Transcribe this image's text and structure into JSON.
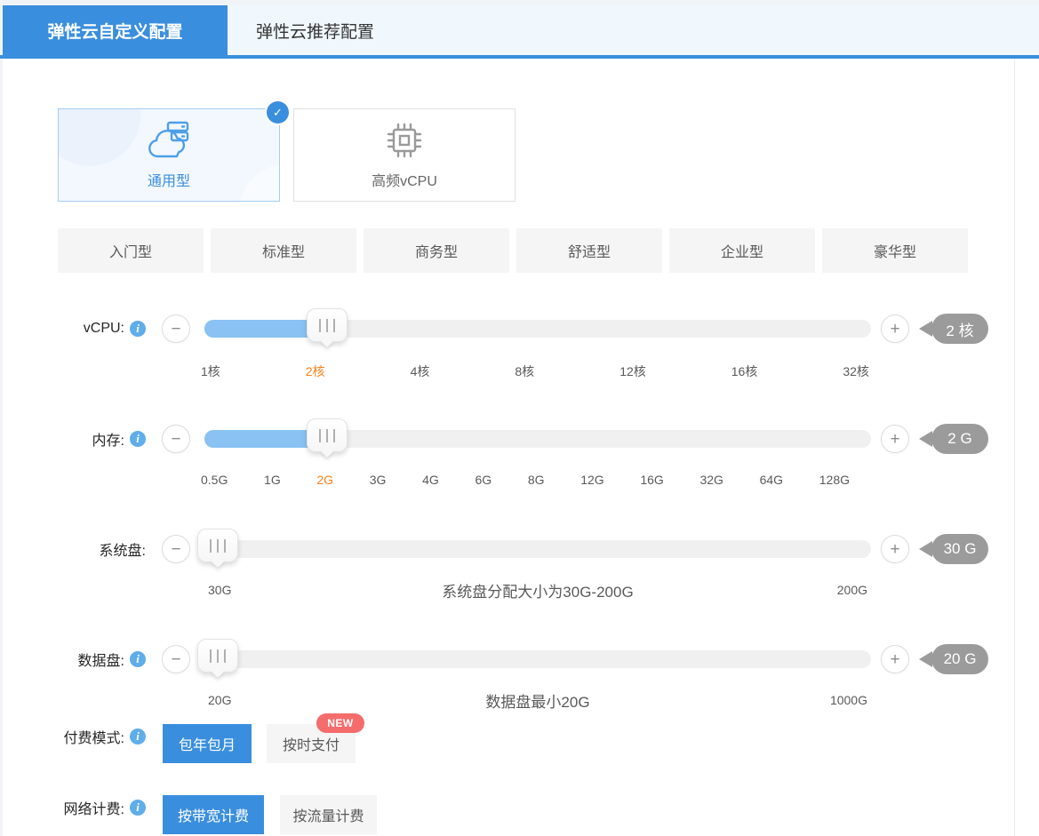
{
  "colors": {
    "accent": "#3A8EDE",
    "slider_fill": "#89C2F3",
    "badge_gray": "#9B9B9B",
    "active_tick_orange": "#F8821E",
    "new_badge_red": "#F56C6C"
  },
  "tabs": [
    {
      "label": "弹性云自定义配置",
      "cls": "active"
    },
    {
      "label": "弹性云推荐配置",
      "cls": ""
    }
  ],
  "instance_types": [
    {
      "label": "通用型",
      "selected": true
    },
    {
      "label": "高频vCPU",
      "selected": false
    }
  ],
  "presets": [
    "入门型",
    "标准型",
    "商务型",
    "舒适型",
    "企业型",
    "豪华型"
  ],
  "sliders": {
    "vcpu": {
      "label": "vCPU:",
      "badge": "2 核",
      "fill": "18.4%",
      "ticks": [
        {
          "t": "1核",
          "cls": ""
        },
        {
          "t": "2核",
          "cls": "active"
        },
        {
          "t": "4核",
          "cls": ""
        },
        {
          "t": "8核",
          "cls": ""
        },
        {
          "t": "12核",
          "cls": ""
        },
        {
          "t": "16核",
          "cls": ""
        },
        {
          "t": "32核",
          "cls": ""
        }
      ]
    },
    "memory": {
      "label": "内存:",
      "badge": "2 G",
      "fill": "18.4%",
      "ticks": [
        {
          "t": "0.5G",
          "cls": ""
        },
        {
          "t": "1G",
          "cls": ""
        },
        {
          "t": "2G",
          "cls": "active"
        },
        {
          "t": "3G",
          "cls": ""
        },
        {
          "t": "4G",
          "cls": ""
        },
        {
          "t": "6G",
          "cls": ""
        },
        {
          "t": "8G",
          "cls": ""
        },
        {
          "t": "12G",
          "cls": ""
        },
        {
          "t": "16G",
          "cls": ""
        },
        {
          "t": "32G",
          "cls": ""
        },
        {
          "t": "64G",
          "cls": ""
        },
        {
          "t": "128G",
          "cls": ""
        }
      ]
    },
    "system_disk": {
      "label": "系统盘:",
      "badge": "30 G",
      "fill": "2%",
      "min": "30G",
      "hint": "系统盘分配大小为30G-200G",
      "max": "200G"
    },
    "data_disk": {
      "label": "数据盘:",
      "badge": "20 G",
      "fill": "2%",
      "min": "20G",
      "hint": "数据盘最小20G",
      "max": "1000G"
    }
  },
  "payment": {
    "label": "付费模式:",
    "option1": "包年包月",
    "option2": "按时支付",
    "new_badge": "NEW"
  },
  "network": {
    "label": "网络计费:",
    "option1": "按带宽计费",
    "option2": "按流量计费"
  }
}
